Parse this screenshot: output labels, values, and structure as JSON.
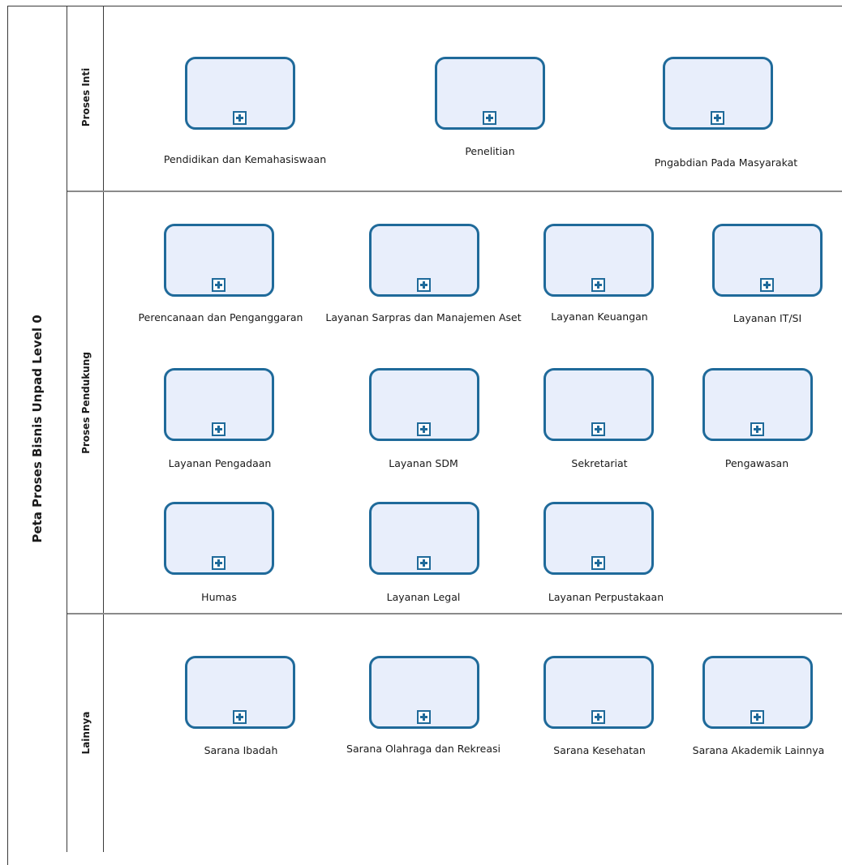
{
  "pool": {
    "title": "Peta Proses Bisnis Unpad Level 0"
  },
  "lanes": [
    {
      "title": "Proses Inti"
    },
    {
      "title": "Proses Pendukung"
    },
    {
      "title": "Lainnya"
    }
  ],
  "tasks": {
    "inti": [
      "Pendidikan dan Kemahasiswaan",
      "Penelitian",
      "Pngabdian Pada Masyarakat"
    ],
    "pendukung": [
      "Perencanaan  dan Penganggaran",
      "Layanan Sarpras dan Manajemen Aset",
      "Layanan Keuangan",
      "Layanan IT/SI",
      "Layanan Pengadaan",
      "Layanan SDM",
      "Sekretariat",
      "Pengawasan",
      "Humas",
      "Layanan Legal",
      "Layanan Perpustakaan"
    ],
    "lainnya": [
      "Sarana Ibadah",
      "Sarana Olahraga dan Rekreasi",
      "Sarana Kesehatan",
      "Sarana Akademik Lainnya"
    ]
  },
  "colors": {
    "task_border": "#1f6a9a",
    "task_fill": "#e8eefb"
  },
  "icons": {
    "subprocess_marker": "plus-square-icon"
  }
}
